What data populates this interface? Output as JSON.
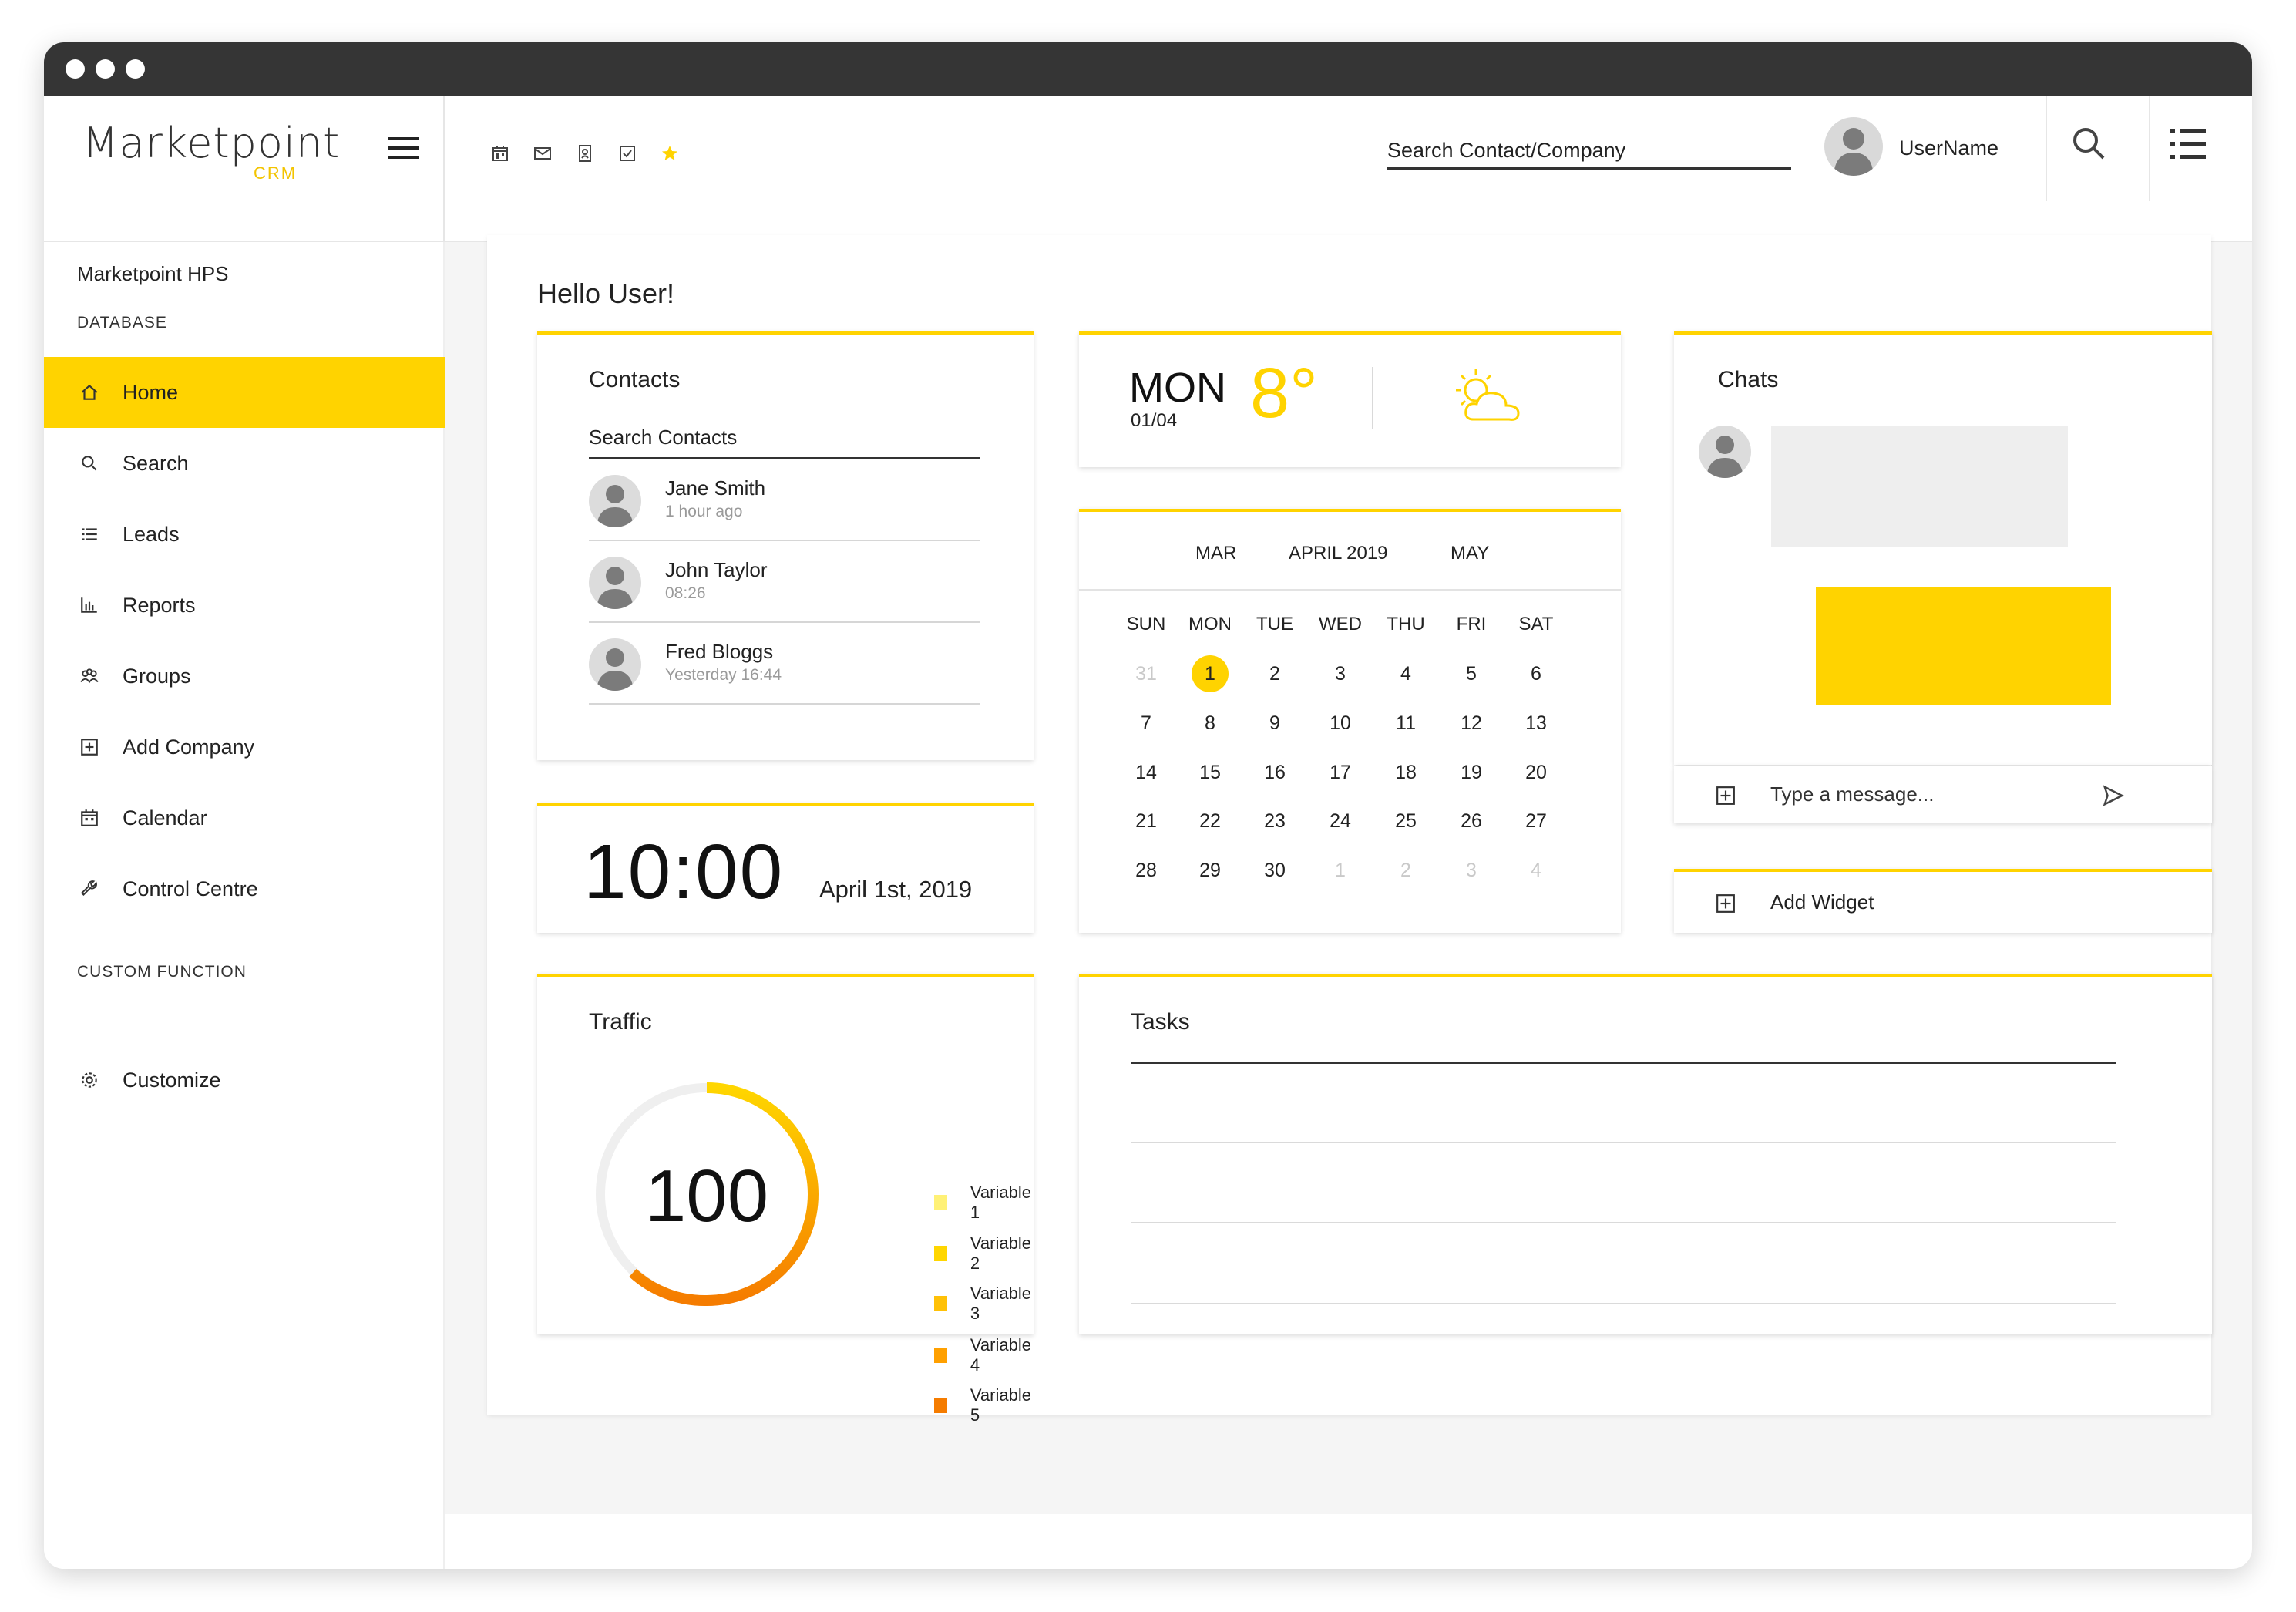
{
  "app": {
    "logo_main": "Marketpoint",
    "logo_sub": "CRM",
    "search_placeholder": "Search Contact/Company",
    "username": "UserName"
  },
  "toolbar_icons": [
    "calendar-icon",
    "mail-icon",
    "contact-card-icon",
    "checkbox-icon",
    "star-icon"
  ],
  "sidebar": {
    "company": "Marketpoint HPS",
    "section_database": "DATABASE",
    "items": [
      {
        "label": "Home",
        "icon": "home-icon",
        "active": true
      },
      {
        "label": "Search",
        "icon": "search-icon"
      },
      {
        "label": "Leads",
        "icon": "list-icon"
      },
      {
        "label": "Reports",
        "icon": "bar-chart-icon"
      },
      {
        "label": "Groups",
        "icon": "groups-icon"
      },
      {
        "label": "Add Company",
        "icon": "add-box-icon"
      },
      {
        "label": "Calendar",
        "icon": "calendar-icon"
      },
      {
        "label": "Control Centre",
        "icon": "wrench-icon"
      }
    ],
    "section_custom": "CUSTOM FUNCTION",
    "custom_items": [
      {
        "label": "Customize",
        "icon": "gear-icon"
      }
    ]
  },
  "greeting": "Hello User!",
  "contacts": {
    "title": "Contacts",
    "search_label": "Search Contacts",
    "list": [
      {
        "name": "Jane Smith",
        "time": "1 hour ago"
      },
      {
        "name": "John Taylor",
        "time": "08:26"
      },
      {
        "name": "Fred Bloggs",
        "time": "Yesterday 16:44"
      }
    ]
  },
  "clock": {
    "time": "10:00",
    "date": "April 1st, 2019"
  },
  "weather": {
    "day": "MON",
    "date": "01/04",
    "temp": "8°",
    "icon": "partly-cloudy-icon"
  },
  "calendar": {
    "prev": "MAR",
    "current": "APRIL 2019",
    "next": "MAY",
    "weekdays": [
      "SUN",
      "MON",
      "TUE",
      "WED",
      "THU",
      "FRI",
      "SAT"
    ],
    "weeks": [
      [
        "31",
        "1",
        "2",
        "3",
        "4",
        "5",
        "6"
      ],
      [
        "7",
        "8",
        "9",
        "10",
        "11",
        "12",
        "13"
      ],
      [
        "14",
        "15",
        "16",
        "17",
        "18",
        "19",
        "20"
      ],
      [
        "21",
        "22",
        "23",
        "24",
        "25",
        "26",
        "27"
      ],
      [
        "28",
        "29",
        "30",
        "1",
        "2",
        "3",
        "4"
      ]
    ],
    "today": "1"
  },
  "chats": {
    "title": "Chats",
    "message_placeholder": "Type a message..."
  },
  "add_widget": "Add Widget",
  "traffic": {
    "title": "Traffic",
    "value": "100",
    "legend": [
      {
        "label": "Variable 1",
        "color": "#fff176"
      },
      {
        "label": "Variable 2",
        "color": "#ffd600"
      },
      {
        "label": "Variable 3",
        "color": "#ffc107"
      },
      {
        "label": "Variable 4",
        "color": "#ffa000"
      },
      {
        "label": "Variable 5",
        "color": "#f57c00"
      }
    ]
  },
  "tasks": {
    "title": "Tasks"
  },
  "colors": {
    "accent": "#ffd300",
    "titlebar": "#353535"
  }
}
